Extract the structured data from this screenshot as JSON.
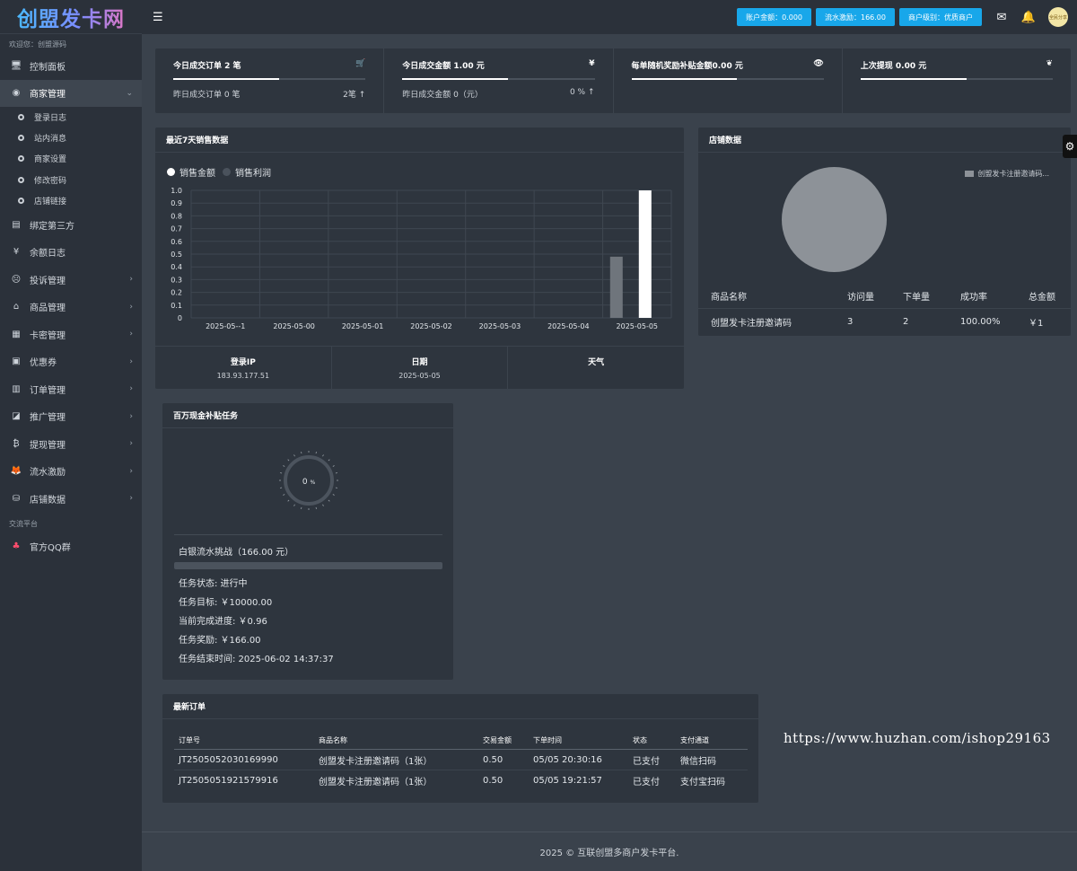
{
  "sidebar": {
    "logo": "创盟发卡网",
    "welcome": "欢迎您：创盟源码",
    "items": [
      {
        "label": "控制面板",
        "icon": "monitor-icon"
      },
      {
        "label": "商家管理",
        "icon": "user-circle-icon"
      },
      {
        "label": "绑定第三方",
        "icon": "card-icon"
      },
      {
        "label": "余额日志",
        "icon": "yen-icon"
      },
      {
        "label": "投诉管理",
        "icon": "frown-icon"
      },
      {
        "label": "商品管理",
        "icon": "store-icon"
      },
      {
        "label": "卡密管理",
        "icon": "grid-icon"
      },
      {
        "label": "优惠券",
        "icon": "coupon-icon"
      },
      {
        "label": "订单管理",
        "icon": "bar-chart-icon"
      },
      {
        "label": "推广管理",
        "icon": "trend-icon"
      },
      {
        "label": "提现管理",
        "icon": "bitcoin-icon"
      },
      {
        "label": "流水激励",
        "icon": "gitlab-icon"
      },
      {
        "label": "店铺数据",
        "icon": "database-icon"
      }
    ],
    "sub_items": [
      "登录日志",
      "站内消息",
      "商家设置",
      "修改密码",
      "店铺链接"
    ],
    "section_title": "交流平台",
    "qq_label": "官方QQ群"
  },
  "topbar": {
    "balance": "账户金额：0.000",
    "flow": "流水激励：166.00",
    "level": "商户级别：优质商户",
    "avatar_text": "全民分享"
  },
  "stats": [
    {
      "title": "今日成交订单 2 笔",
      "icon": "cart-icon",
      "glyph": "🛒",
      "progress": 0.55,
      "sub_left": "昨日成交订单 0 笔",
      "sub_right": "2笔 ↑"
    },
    {
      "title": "今日成交金额 1.00 元",
      "icon": "yen-icon",
      "glyph": "¥",
      "progress": 0.55,
      "sub_left": "昨日成交金额 0（元）",
      "sub_right": "0 % ↑"
    },
    {
      "title": "每单随机奖励补贴金额0.00 元",
      "icon": "eye-icon",
      "glyph": "👁",
      "progress": 0.55,
      "sub_left": "",
      "sub_right": ""
    },
    {
      "title": "上次提现 0.00 元",
      "icon": "leaf-icon",
      "glyph": "❦",
      "progress": 0.55,
      "sub_left": "",
      "sub_right": ""
    }
  ],
  "sales": {
    "title": "最近7天销售数据",
    "legend": [
      {
        "name": "销售金额",
        "color": "#ffffff"
      },
      {
        "name": "销售利润",
        "color": "#4a525c"
      }
    ],
    "footer": [
      {
        "title": "登录IP",
        "value": "183.93.177.51"
      },
      {
        "title": "日期",
        "value": "2025-05-05"
      },
      {
        "title": "天气",
        "value": ""
      }
    ]
  },
  "chart_data": {
    "type": "bar",
    "title": "最近7天销售数据",
    "categories": [
      "2025-05--1",
      "2025-05-00",
      "2025-05-01",
      "2025-05-02",
      "2025-05-03",
      "2025-05-04",
      "2025-05-05"
    ],
    "series": [
      {
        "name": "销售金额",
        "values": [
          0,
          0,
          0,
          0,
          0,
          0,
          1.0
        ],
        "color": "#ffffff"
      },
      {
        "name": "销售利润",
        "values": [
          0,
          0,
          0,
          0,
          0,
          0,
          0.48
        ],
        "color": "#6f757c"
      }
    ],
    "yticks": [
      "1.0",
      "0.9",
      "0.8",
      "0.7",
      "0.6",
      "0.5",
      "0.4",
      "0.3",
      "0.2",
      "0.1",
      "0"
    ],
    "ylim": [
      0,
      1.0
    ],
    "grid": true,
    "legend": "top-left"
  },
  "store": {
    "title": "店铺数据",
    "legend": "创盟发卡注册邀请码...",
    "headers": [
      "商品名称",
      "访问量",
      "下单量",
      "成功率",
      "总金额"
    ],
    "rows": [
      [
        "创盟发卡注册邀请码",
        "3",
        "2",
        "100.00%",
        "￥1"
      ]
    ]
  },
  "task": {
    "title": "百万现金补贴任务",
    "percent": "0",
    "percent_unit": "%",
    "name": "白银流水挑战（166.00 元）",
    "progress": 0.0,
    "lines": [
      "任务状态: 进行中",
      "任务目标: ￥10000.00",
      "当前完成进度: ￥0.96",
      "任务奖励: ￥166.00",
      "任务结束时间: 2025-06-02 14:37:37"
    ]
  },
  "orders": {
    "title": "最新订单",
    "headers": [
      "订单号",
      "商品名称",
      "交易金额",
      "下单时间",
      "状态",
      "支付通道"
    ],
    "rows": [
      [
        "JT2505052030169990",
        "创盟发卡注册邀请码（1张）",
        "0.50",
        "05/05 20:30:16",
        "已支付",
        "微信扫码"
      ],
      [
        "JT2505051921579916",
        "创盟发卡注册邀请码（1张）",
        "0.50",
        "05/05 19:21:57",
        "已支付",
        "支付宝扫码"
      ]
    ]
  },
  "watermark": "https://www.huzhan.com/ishop29163",
  "footer": "2025 © 互联创盟多商户发卡平台."
}
